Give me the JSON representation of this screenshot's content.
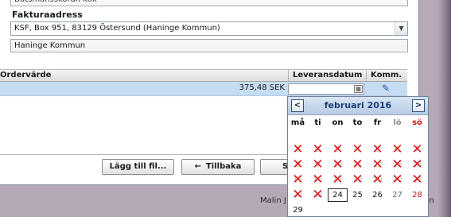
{
  "form": {
    "top_field_value": "Butsmanssköran kök",
    "invoice_address_label": "Fakturaadress",
    "invoice_address_value": "KSF, Box 951, 83129 Östersund (Haninge Kommun)",
    "invoice_name_value": "Haninge Kommun"
  },
  "table": {
    "col_order_value": "Ordervärde",
    "col_delivery_date": "Leveransdatum",
    "col_comment": "Komm.",
    "row_amount": "375,48 SEK",
    "row_delivery_date": ""
  },
  "buttons": {
    "add_file": "Lägg till fil...",
    "back_arrow": "←",
    "back": "Tillbaka",
    "next": "S"
  },
  "status": {
    "user": "Malin J",
    "tail": "un"
  },
  "datepicker": {
    "prev": "<",
    "next": ">",
    "month_title": "februari 2016",
    "weekdays": [
      "må",
      "ti",
      "on",
      "to",
      "fr",
      "lö",
      "sö"
    ],
    "today": "24",
    "rows": [
      [
        {
          "d": "1",
          "x": true
        },
        {
          "d": "2",
          "x": true
        },
        {
          "d": "3",
          "x": true
        },
        {
          "d": "4",
          "x": true
        },
        {
          "d": "5",
          "x": true
        },
        {
          "d": "6",
          "x": true
        },
        {
          "d": "7",
          "x": true
        }
      ],
      [
        {
          "d": "8",
          "x": true
        },
        {
          "d": "9",
          "x": true
        },
        {
          "d": "10",
          "x": true
        },
        {
          "d": "11",
          "x": true
        },
        {
          "d": "12",
          "x": true
        },
        {
          "d": "13",
          "x": true
        },
        {
          "d": "14",
          "x": true
        }
      ],
      [
        {
          "d": "15",
          "x": true
        },
        {
          "d": "16",
          "x": true
        },
        {
          "d": "17",
          "x": true
        },
        {
          "d": "18",
          "x": true
        },
        {
          "d": "19",
          "x": true
        },
        {
          "d": "20",
          "x": true
        },
        {
          "d": "21",
          "x": true
        }
      ],
      [
        {
          "d": "22",
          "x": true
        },
        {
          "d": "23",
          "x": true
        },
        {
          "d": "24",
          "x": false
        },
        {
          "d": "25",
          "x": false
        },
        {
          "d": "26",
          "x": false
        },
        {
          "d": "27",
          "x": false
        },
        {
          "d": "28",
          "x": false
        }
      ],
      [
        {
          "d": "29",
          "x": false
        }
      ]
    ]
  }
}
